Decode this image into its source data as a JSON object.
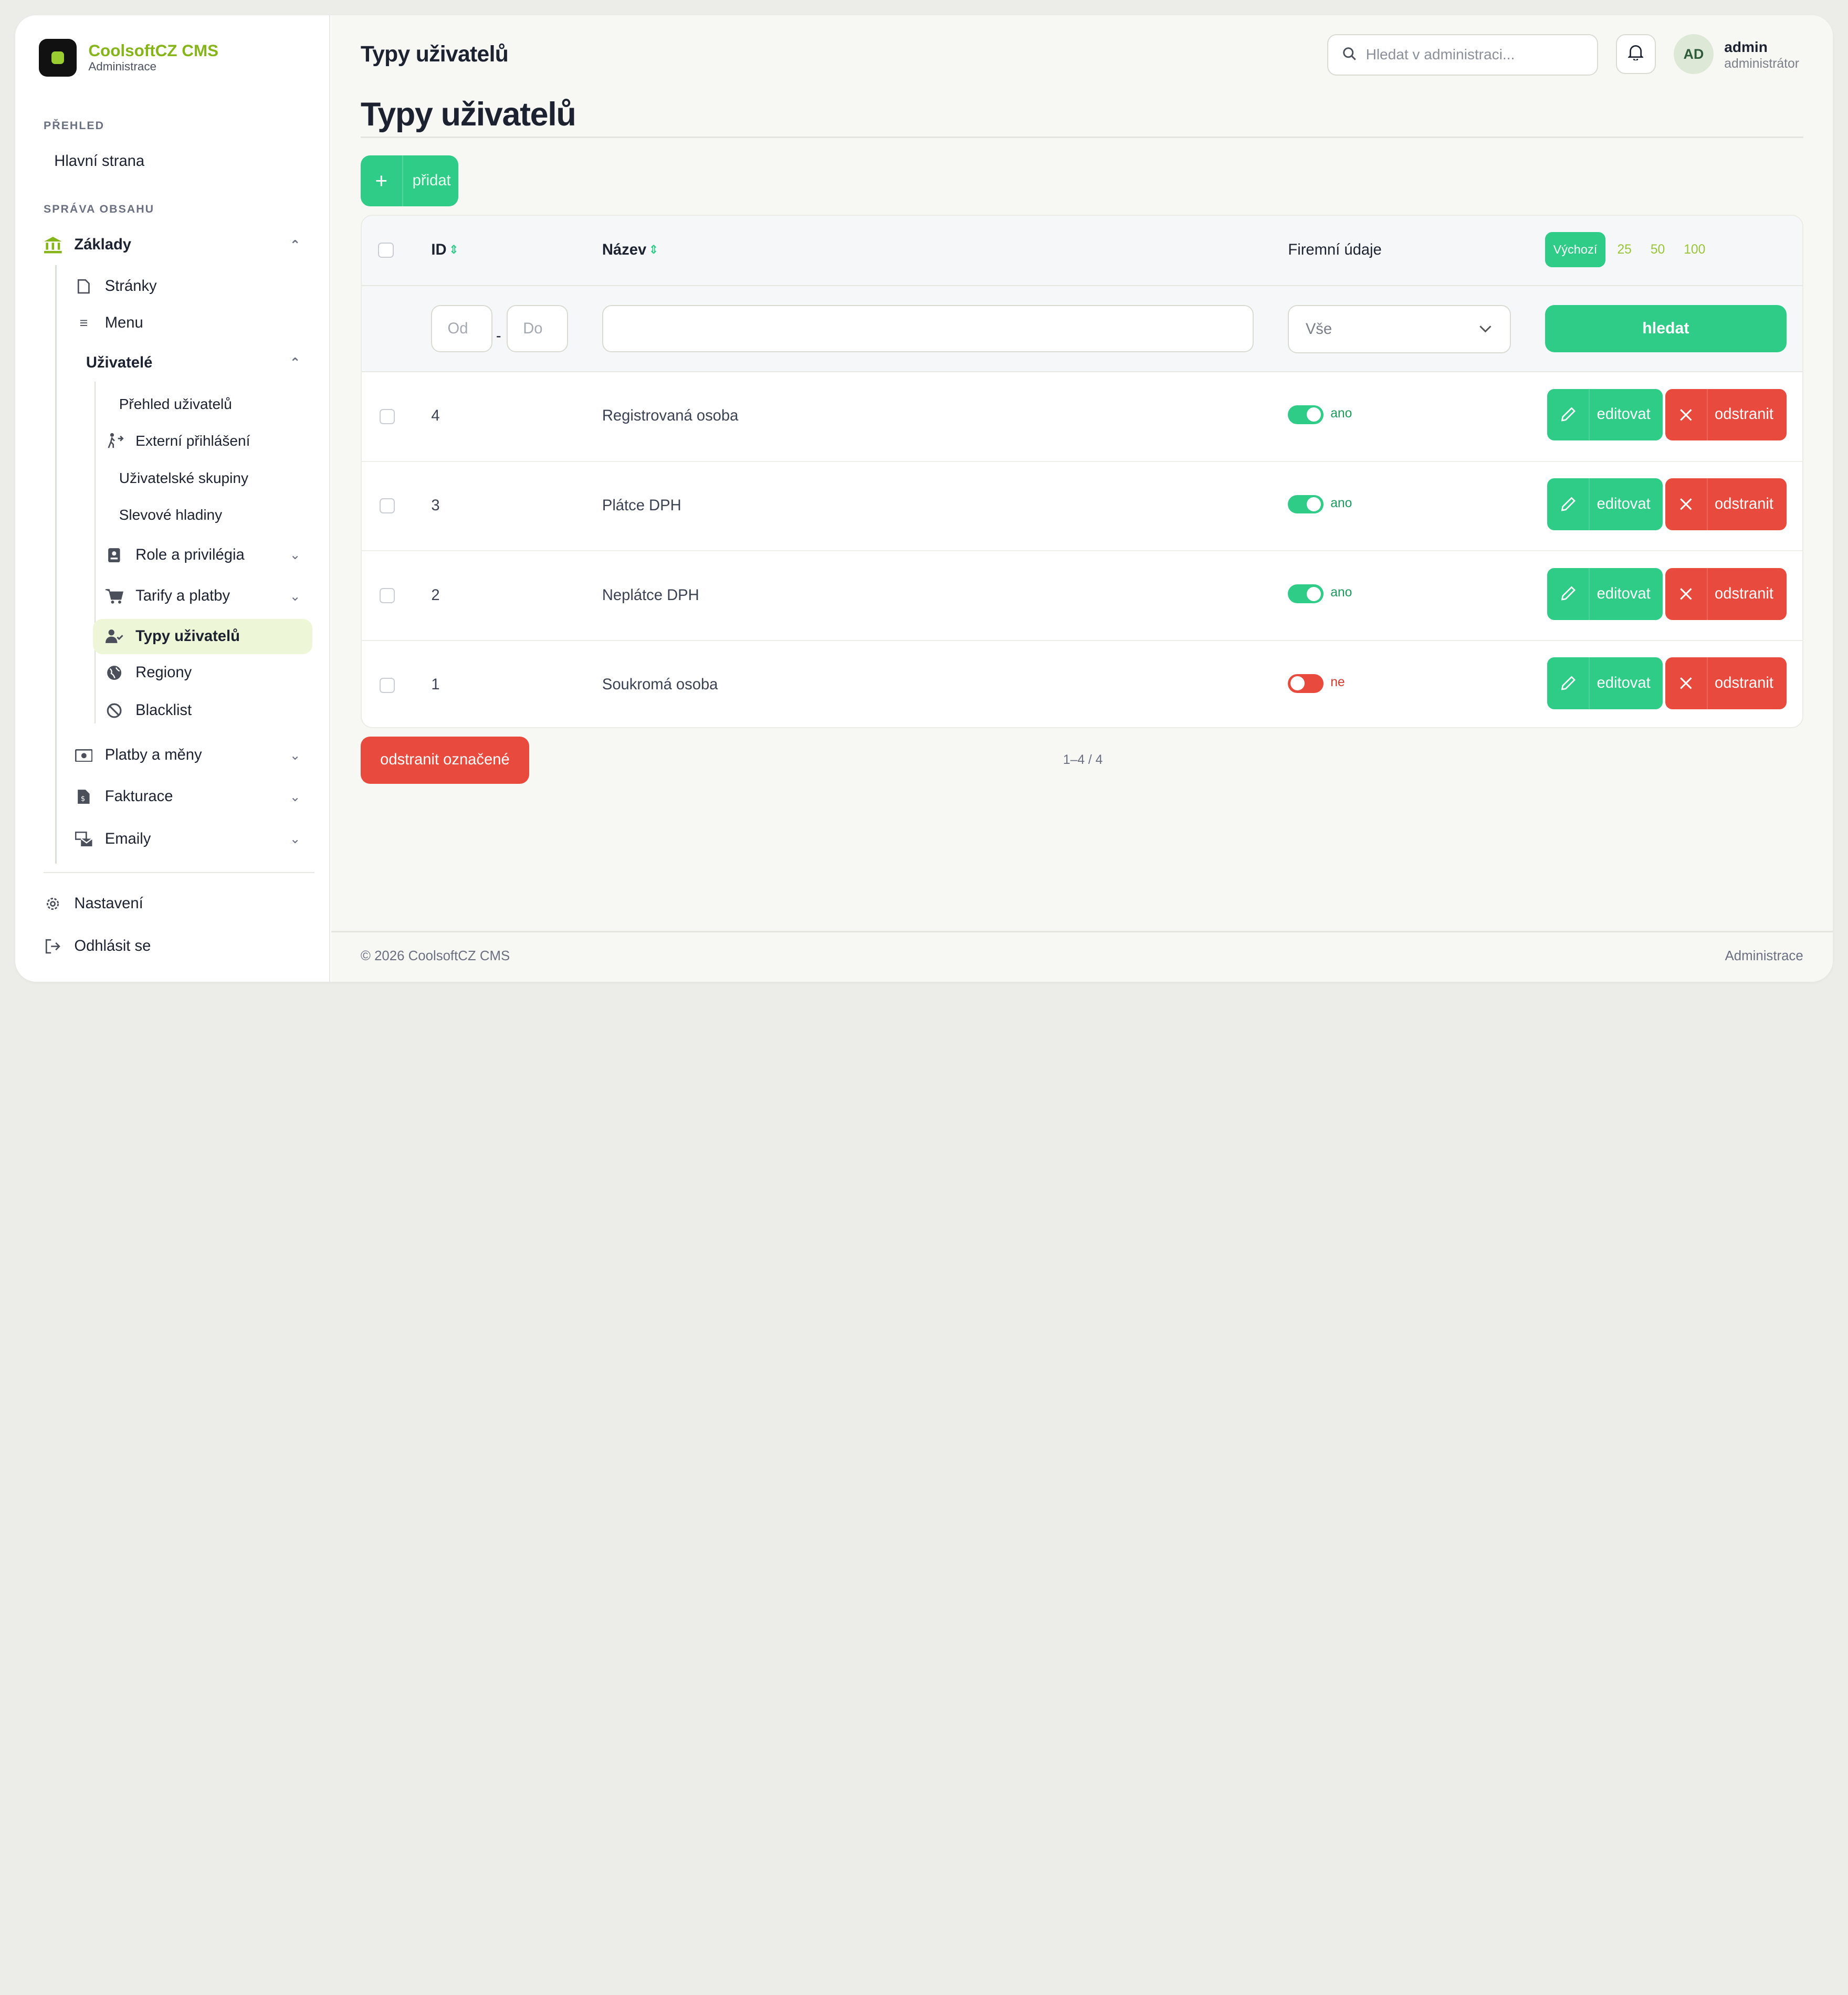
{
  "brand": {
    "name": "CoolsoftCZ CMS",
    "sub": "Administrace",
    "accent": "#86b51a"
  },
  "sidebar": {
    "section_overview": "PŘEHLED",
    "home": "Hlavní strana",
    "section_content": "SPRÁVA OBSAHU",
    "zaklady": "Základy",
    "stranky": "Stránky",
    "menu": "Menu",
    "uzivatele": "Uživatelé",
    "prehled_uzivatelu": "Přehled uživatelů",
    "externi_prihlaseni": "Externí přihlášení",
    "uzivatelske_skupiny": "Uživatelské skupiny",
    "slevove_hladiny": "Slevové hladiny",
    "role": "Role a privilégia",
    "tarify": "Tarify a platby",
    "typy_uzivatelu": "Typy uživatelů",
    "regiony": "Regiony",
    "blacklist": "Blacklist",
    "platby": "Platby a měny",
    "fakturace": "Fakturace",
    "emaily": "Emaily",
    "nastaveni": "Nastavení",
    "odhlasit": "Odhlásit se"
  },
  "header": {
    "title": "Typy uživatelů",
    "search_placeholder": "Hledat v administraci...",
    "avatar": "AD",
    "user_name": "admin",
    "user_role": "administrátor"
  },
  "page": {
    "title": "Typy uživatelů",
    "add_label": "přidat"
  },
  "table": {
    "columns": {
      "id": "ID",
      "name": "Název",
      "company": "Firemní údaje"
    },
    "page_sizes": [
      "Výchozí",
      "25",
      "50",
      "100"
    ],
    "filters": {
      "from": "Od",
      "to": "Do",
      "select": "Vše",
      "search": "hledat"
    },
    "rows": [
      {
        "id": "4",
        "name": "Registrovaná osoba",
        "company": true,
        "company_label": "ano"
      },
      {
        "id": "3",
        "name": "Plátce DPH",
        "company": true,
        "company_label": "ano"
      },
      {
        "id": "2",
        "name": "Neplátce DPH",
        "company": true,
        "company_label": "ano"
      },
      {
        "id": "1",
        "name": "Soukromá osoba",
        "company": false,
        "company_label": "ne"
      }
    ],
    "edit_label": "editovat",
    "delete_label": "odstranit"
  },
  "bulk": {
    "delete_marked": "odstranit označené",
    "count": "1–4 / 4"
  },
  "footer": {
    "copyright": "© 2026 CoolsoftCZ CMS",
    "right": "Administrace"
  },
  "colors": {
    "green": "#2ecc86",
    "red": "#e84a3d",
    "active_bg": "#eef6d8"
  }
}
